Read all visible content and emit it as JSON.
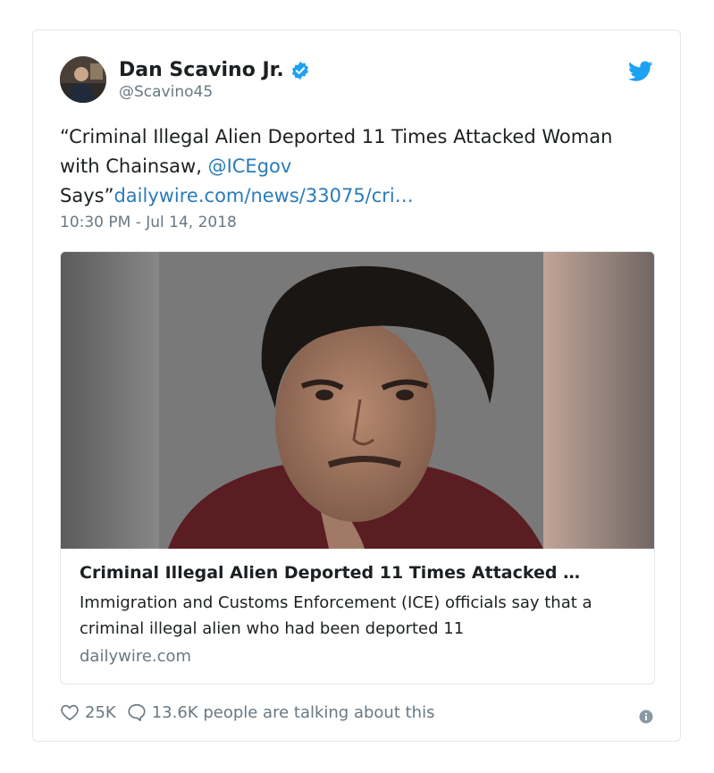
{
  "tweet": {
    "author_name": "Dan Scavino Jr.",
    "handle": "@Scavino45",
    "text_part1": "“Criminal Illegal Alien Deported 11 Times Attacked Woman with Chainsaw, ",
    "mention": "@ICEgov",
    "text_part2": " Says”",
    "link_text": "dailywire.com/news/33075/cri…",
    "timestamp": "10:30 PM - Jul 14, 2018"
  },
  "card": {
    "title": "Criminal Illegal Alien Deported 11 Times Attacked …",
    "description": "Immigration and Customs Enforcement (ICE) officials say that a criminal illegal alien who had been deported 11",
    "domain": "dailywire.com"
  },
  "actions": {
    "likes": "25K",
    "talking": "13.6K people are talking about this"
  },
  "icons": {
    "verified": "verified-badge-icon",
    "brand": "twitter-bird-icon",
    "like": "heart-icon",
    "reply": "speech-bubble-icon",
    "info": "info-icon"
  },
  "colors": {
    "link": "#2b7bb9",
    "muted": "#697882",
    "border": "#e1e8ed",
    "brand": "#1da1f2"
  }
}
